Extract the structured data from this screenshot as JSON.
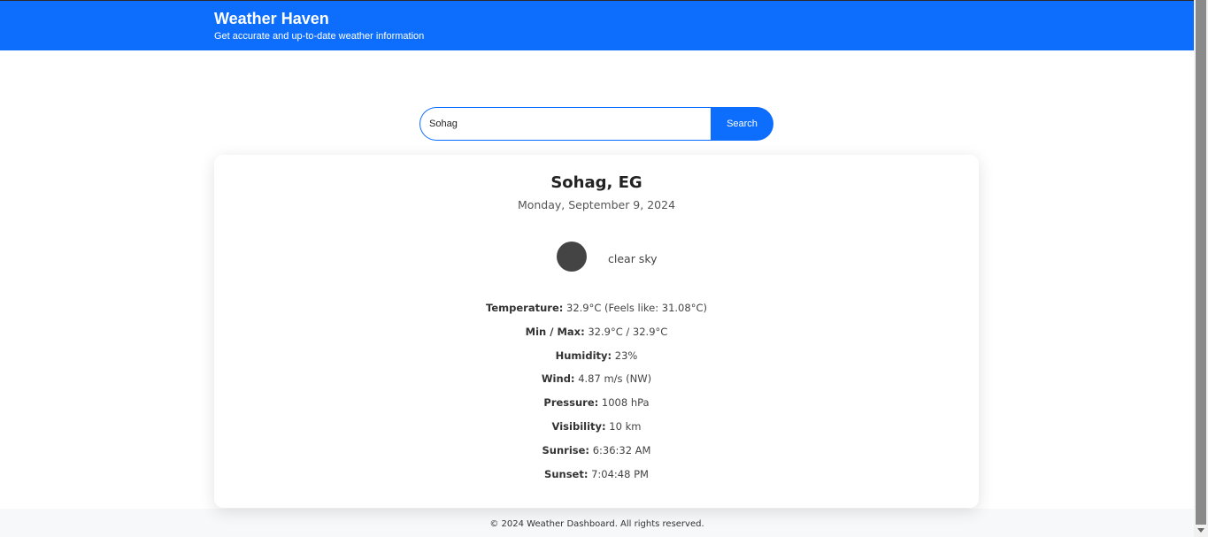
{
  "header": {
    "title": "Weather Haven",
    "subtitle": "Get accurate and up-to-date weather information"
  },
  "search": {
    "value": "Sohag",
    "button_label": "Search"
  },
  "weather": {
    "location": "Sohag, EG",
    "date": "Monday, September 9, 2024",
    "icon": "weather-icon",
    "description": "clear sky",
    "details": [
      {
        "label": "Temperature:",
        "value": "32.9°C (Feels like: 31.08°C)"
      },
      {
        "label": "Min / Max:",
        "value": "32.9°C / 32.9°C"
      },
      {
        "label": "Humidity:",
        "value": "23%"
      },
      {
        "label": "Wind:",
        "value": "4.87 m/s (NW)"
      },
      {
        "label": "Pressure:",
        "value": "1008 hPa"
      },
      {
        "label": "Visibility:",
        "value": "10 km"
      },
      {
        "label": "Sunrise:",
        "value": "6:36:32 AM"
      },
      {
        "label": "Sunset:",
        "value": "7:04:48 PM"
      }
    ]
  },
  "footer": {
    "text": "© 2024 Weather Dashboard. All rights reserved."
  },
  "colors": {
    "primary": "#0d6efd",
    "footer_bg": "#f7f8fa",
    "icon_fill": "#444444"
  }
}
